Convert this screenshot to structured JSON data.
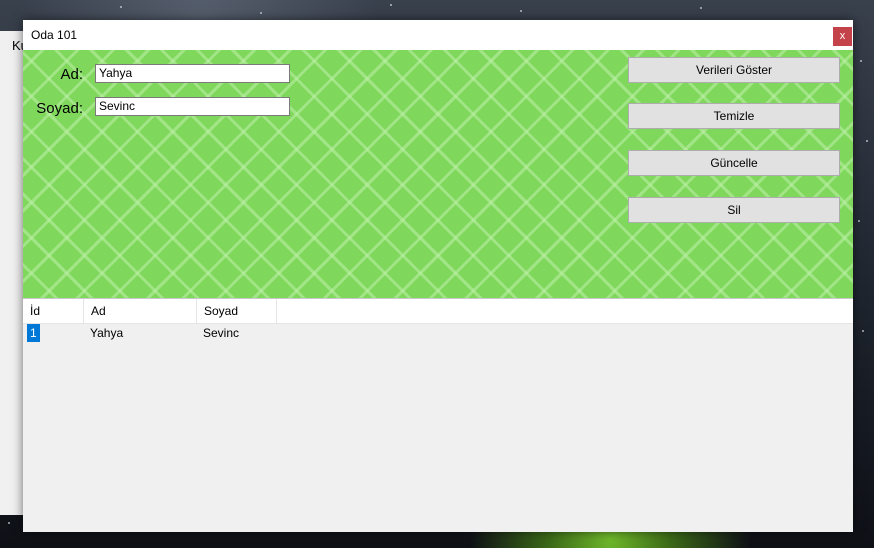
{
  "background_window": {
    "title_fragment": "Ku"
  },
  "window": {
    "title": "Oda 101",
    "close_label": "x"
  },
  "form": {
    "ad_label": "Ad:",
    "ad_value": "Yahya",
    "soyad_label": "Soyad:",
    "soyad_value": "Sevinc"
  },
  "buttons": {
    "show": "Verileri Göster",
    "clear": "Temizle",
    "update": "Güncelle",
    "delete": "Sil"
  },
  "grid": {
    "columns": [
      "İd",
      "Ad",
      "Soyad"
    ],
    "rows": [
      {
        "id": "1",
        "ad": "Yahya",
        "soyad": "Sevinc"
      }
    ]
  },
  "colors": {
    "panel_green": "#7fd85b",
    "close_red": "#c4424a",
    "selection_blue": "#0078d7"
  }
}
